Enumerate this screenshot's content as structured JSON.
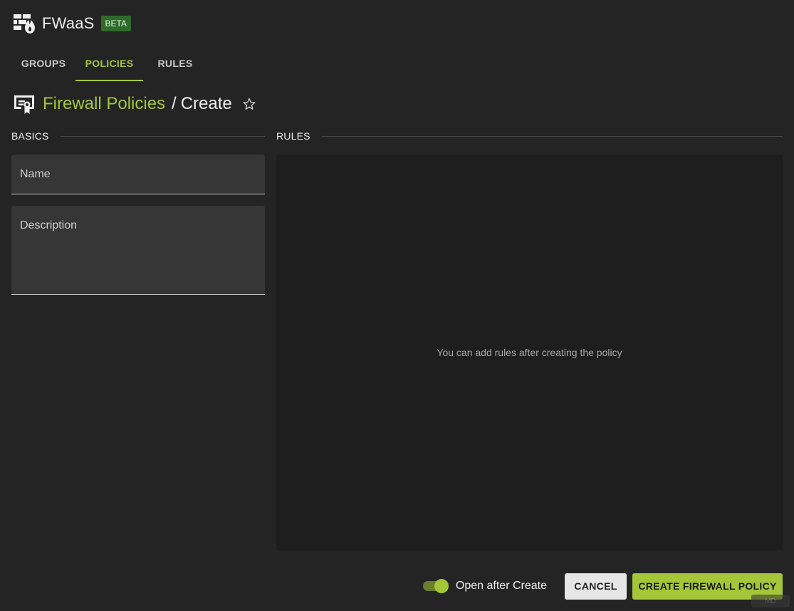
{
  "app": {
    "title": "FWaaS",
    "badge": "BETA",
    "icon": "firewall-icon"
  },
  "tabs": [
    {
      "label": "GROUPS",
      "active": false
    },
    {
      "label": "POLICIES",
      "active": true
    },
    {
      "label": "RULES",
      "active": false
    }
  ],
  "page": {
    "icon": "policy-certificate-icon",
    "breadcrumb_link": "Firewall Policies",
    "separator": "/",
    "current": "Create",
    "favorite_icon": "star-outline-icon"
  },
  "basics": {
    "section_label": "BASICS",
    "name_label": "Name",
    "name_value": "",
    "description_label": "Description",
    "description_value": ""
  },
  "rules": {
    "section_label": "RULES",
    "empty_message": "You can add rules after creating the policy"
  },
  "footer": {
    "toggle_label": "Open after Create",
    "toggle_on": true,
    "cancel_label": "CANCEL",
    "create_label": "CREATE FIREWALL POLICY",
    "md_badge": "MD"
  },
  "colors": {
    "accent": "#a4c639",
    "background": "#242424",
    "panel": "#1e1e1e",
    "field": "#363636",
    "beta_badge": "#2e6b2a"
  }
}
